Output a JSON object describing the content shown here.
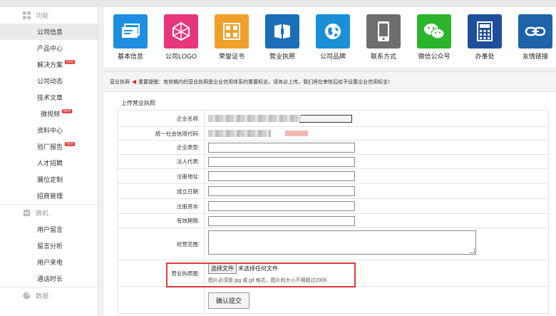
{
  "sidebar": {
    "groups": [
      {
        "label": "功能",
        "icon": "grid-icon",
        "items": [
          {
            "label": "公司信息",
            "active": true
          },
          {
            "label": "产品中心"
          },
          {
            "label": "解决方案",
            "hot": "NEW"
          },
          {
            "label": "公司动态"
          },
          {
            "label": "技术文章"
          },
          {
            "label": "微视频",
            "hot": "NEW",
            "indent": true
          },
          {
            "label": "资料中心"
          },
          {
            "label": "验厂报告",
            "hot": "NEW"
          },
          {
            "label": "人才招聘"
          },
          {
            "label": "展位定制"
          },
          {
            "label": "招商管理"
          }
        ]
      },
      {
        "label": "商机",
        "icon": "inbox-icon",
        "items": [
          {
            "label": "用户留言"
          },
          {
            "label": "留言分析"
          },
          {
            "label": "用户来电"
          },
          {
            "label": "通话时长"
          }
        ]
      },
      {
        "label": "数据",
        "icon": "pie-icon",
        "items": []
      }
    ]
  },
  "icons": [
    {
      "label": "基本信息",
      "color": "#1e8fe0",
      "name": "basic-info-icon"
    },
    {
      "label": "公司LOGO",
      "color": "#e8367c",
      "name": "company-logo-icon"
    },
    {
      "label": "荣誉证书",
      "color": "#f0a02a",
      "name": "honor-certificate-icon"
    },
    {
      "label": "营业执照",
      "color": "#1a6fb8",
      "name": "business-license-icon"
    },
    {
      "label": "公司品牌",
      "color": "#1a8fd6",
      "name": "company-brand-icon"
    },
    {
      "label": "联系方式",
      "color": "#6e6e6e",
      "name": "contact-icon"
    },
    {
      "label": "微信公众号",
      "color": "#2ab52a",
      "name": "wechat-icon"
    },
    {
      "label": "办事处",
      "color": "#1d4f9a",
      "name": "office-icon"
    },
    {
      "label": "友情链接",
      "color": "#1f63a8",
      "name": "friend-link-icon"
    }
  ],
  "notice": {
    "prefix": "营业执照",
    "title": "重要提醒：",
    "text": "有效期内的营业执照是企业信用体系的重要标志，请务必上传，我们将在审核后给予设置企业信用标志！"
  },
  "section_title": "上传营业执照",
  "form": {
    "company_name_label": "企业名称:",
    "credit_code_label": "统一社会信用代码:",
    "company_type_label": "企业类型:",
    "legal_rep_label": "法人代表:",
    "address_label": "注册地址:",
    "founded_label": "成立日期:",
    "capital_label": "注册资本:",
    "validity_label": "有效期限:",
    "scope_label": "经营范围:",
    "license_image_label": "营业执照图:",
    "file_button": "选择文件",
    "file_status": "未选择任何文件",
    "file_hint": "图片必须是 jpg 或 gif 格式，图片的大小不得超过200K",
    "submit_label": "确认提交"
  },
  "colors": {
    "alert_red": "#e03b3b"
  }
}
